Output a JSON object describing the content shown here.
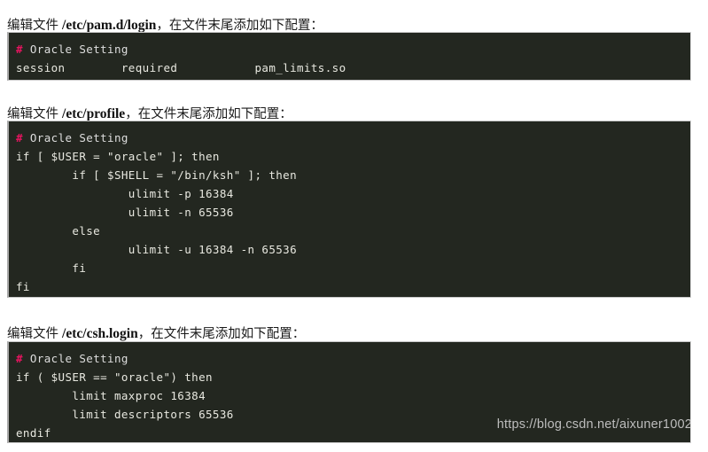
{
  "sections": [
    {
      "label_prefix": "编辑文件 ",
      "path": "/etc/pam.d/login",
      "label_suffix": "，在文件末尾添加如下配置：",
      "code": {
        "comment_hash": "#",
        "comment_text": " Oracle Setting",
        "lines": [
          "session        required           pam_limits.so"
        ]
      }
    },
    {
      "label_prefix": "编辑文件 ",
      "path": "/etc/profile",
      "label_suffix": "，在文件末尾添加如下配置：",
      "code": {
        "comment_hash": "#",
        "comment_text": " Oracle Setting",
        "lines": [
          "if [ $USER = \"oracle\" ]; then",
          "        if [ $SHELL = \"/bin/ksh\" ]; then",
          "                ulimit -p 16384",
          "                ulimit -n 65536",
          "        else",
          "                ulimit -u 16384 -n 65536",
          "        fi",
          "fi"
        ]
      }
    },
    {
      "label_prefix": "编辑文件 ",
      "path": "/etc/csh.login",
      "label_suffix": "，在文件末尾添加如下配置：",
      "code": {
        "comment_hash": "#",
        "comment_text": " Oracle Setting",
        "lines": [
          "if ( $USER == \"oracle\") then",
          "        limit maxproc 16384",
          "        limit descriptors 65536",
          "endif"
        ]
      }
    }
  ],
  "watermark": {
    "text": "https://blog.csdn.net/aixuner1002"
  },
  "colors": {
    "code_background": "#232720",
    "code_text": "#e8e8e0",
    "comment_accent": "#e6145f",
    "page_background": "#ffffff",
    "body_text": "#1a1a1a",
    "watermark_text": "#bdbdbd"
  }
}
